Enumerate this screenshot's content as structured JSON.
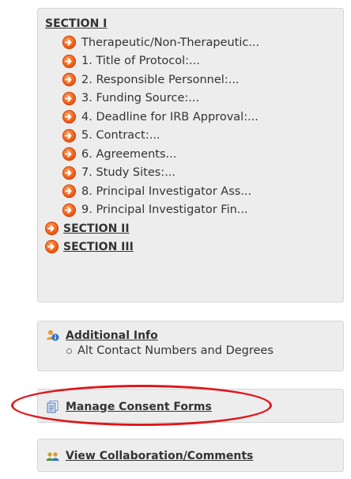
{
  "sections_panel": {
    "section_i": {
      "label": "SECTION I",
      "items": [
        {
          "label": "Therapeutic/Non-Therapeutic..."
        },
        {
          "label": "1. Title of Protocol:..."
        },
        {
          "label": "2. Responsible Personnel:..."
        },
        {
          "label": "3. Funding Source:..."
        },
        {
          "label": "4. Deadline for IRB Approval:..."
        },
        {
          "label": "5. Contract:..."
        },
        {
          "label": "6. Agreements..."
        },
        {
          "label": "7. Study Sites:..."
        },
        {
          "label": "8. Principal Investigator Ass..."
        },
        {
          "label": "9. Principal Investigator Fin..."
        }
      ]
    },
    "section_ii": {
      "label": "SECTION II"
    },
    "section_iii": {
      "label": "SECTION III"
    }
  },
  "additional_info": {
    "label": "Additional Info",
    "sub_items": [
      {
        "label": "Alt Contact Numbers and Degrees"
      }
    ]
  },
  "manage_consent": {
    "label": "Manage Consent Forms"
  },
  "collaboration": {
    "label": "View Collaboration/Comments"
  },
  "colors": {
    "panel_bg": "#ededed",
    "arrow_orange": "#ee5b12",
    "highlight_red": "#e0161b"
  },
  "icons": {
    "item_arrow": "orange-arrow-icon",
    "additional_info": "people-info-icon",
    "manage_consent": "forms-icon",
    "collaboration": "collaboration-icon"
  }
}
